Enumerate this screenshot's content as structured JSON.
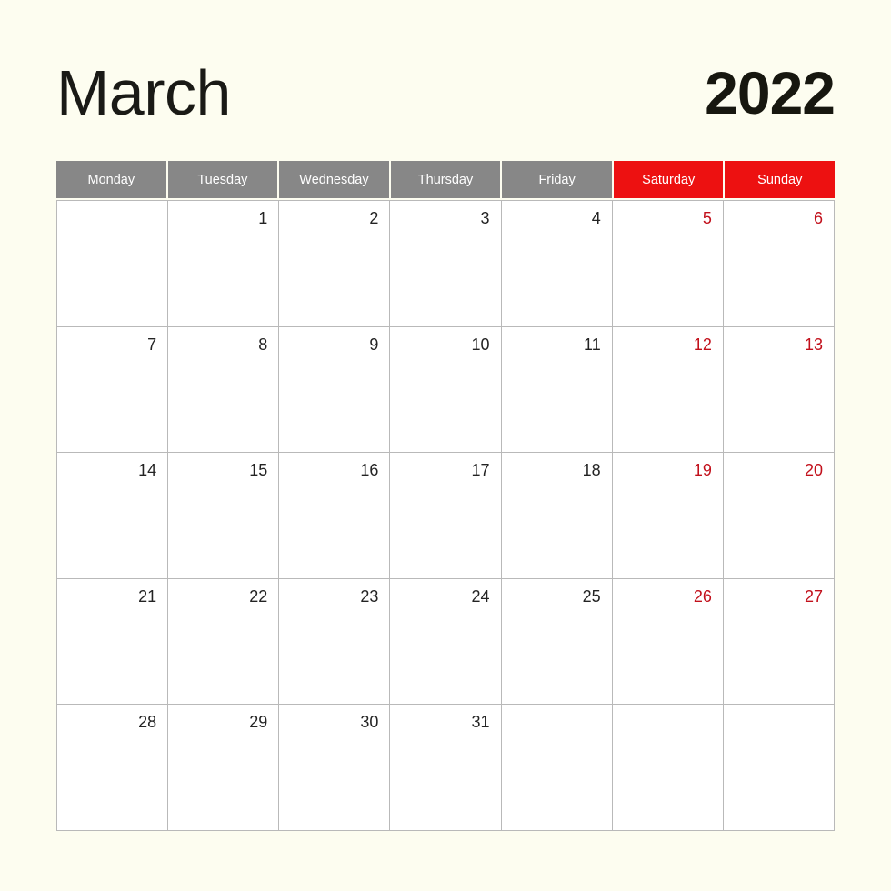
{
  "calendar": {
    "month": "March",
    "year": "2022",
    "colors": {
      "background": "#fdfdf0",
      "weekday_header": "#878787",
      "weekend_header": "#ed1111",
      "weekend_date_text": "#c2101b",
      "weekday_date_text": "#232323",
      "grid_line": "#b9b9b9",
      "cell_background": "#ffffff",
      "title_text": "#1a1a16"
    },
    "weekdays": [
      {
        "label": "Monday",
        "weekend": false
      },
      {
        "label": "Tuesday",
        "weekend": false
      },
      {
        "label": "Wednesday",
        "weekend": false
      },
      {
        "label": "Thursday",
        "weekend": false
      },
      {
        "label": "Friday",
        "weekend": false
      },
      {
        "label": "Saturday",
        "weekend": true
      },
      {
        "label": "Sunday",
        "weekend": true
      }
    ],
    "weeks": [
      [
        {
          "date": "",
          "weekend": false,
          "empty": true
        },
        {
          "date": "1",
          "weekend": false,
          "empty": false
        },
        {
          "date": "2",
          "weekend": false,
          "empty": false
        },
        {
          "date": "3",
          "weekend": false,
          "empty": false
        },
        {
          "date": "4",
          "weekend": false,
          "empty": false
        },
        {
          "date": "5",
          "weekend": true,
          "empty": false
        },
        {
          "date": "6",
          "weekend": true,
          "empty": false
        }
      ],
      [
        {
          "date": "7",
          "weekend": false,
          "empty": false
        },
        {
          "date": "8",
          "weekend": false,
          "empty": false
        },
        {
          "date": "9",
          "weekend": false,
          "empty": false
        },
        {
          "date": "10",
          "weekend": false,
          "empty": false
        },
        {
          "date": "11",
          "weekend": false,
          "empty": false
        },
        {
          "date": "12",
          "weekend": true,
          "empty": false
        },
        {
          "date": "13",
          "weekend": true,
          "empty": false
        }
      ],
      [
        {
          "date": "14",
          "weekend": false,
          "empty": false
        },
        {
          "date": "15",
          "weekend": false,
          "empty": false
        },
        {
          "date": "16",
          "weekend": false,
          "empty": false
        },
        {
          "date": "17",
          "weekend": false,
          "empty": false
        },
        {
          "date": "18",
          "weekend": false,
          "empty": false
        },
        {
          "date": "19",
          "weekend": true,
          "empty": false
        },
        {
          "date": "20",
          "weekend": true,
          "empty": false
        }
      ],
      [
        {
          "date": "21",
          "weekend": false,
          "empty": false
        },
        {
          "date": "22",
          "weekend": false,
          "empty": false
        },
        {
          "date": "23",
          "weekend": false,
          "empty": false
        },
        {
          "date": "24",
          "weekend": false,
          "empty": false
        },
        {
          "date": "25",
          "weekend": false,
          "empty": false
        },
        {
          "date": "26",
          "weekend": true,
          "empty": false
        },
        {
          "date": "27",
          "weekend": true,
          "empty": false
        }
      ],
      [
        {
          "date": "28",
          "weekend": false,
          "empty": false
        },
        {
          "date": "29",
          "weekend": false,
          "empty": false
        },
        {
          "date": "30",
          "weekend": false,
          "empty": false
        },
        {
          "date": "31",
          "weekend": false,
          "empty": false
        },
        {
          "date": "",
          "weekend": false,
          "empty": true
        },
        {
          "date": "",
          "weekend": true,
          "empty": true
        },
        {
          "date": "",
          "weekend": true,
          "empty": true
        }
      ]
    ]
  }
}
